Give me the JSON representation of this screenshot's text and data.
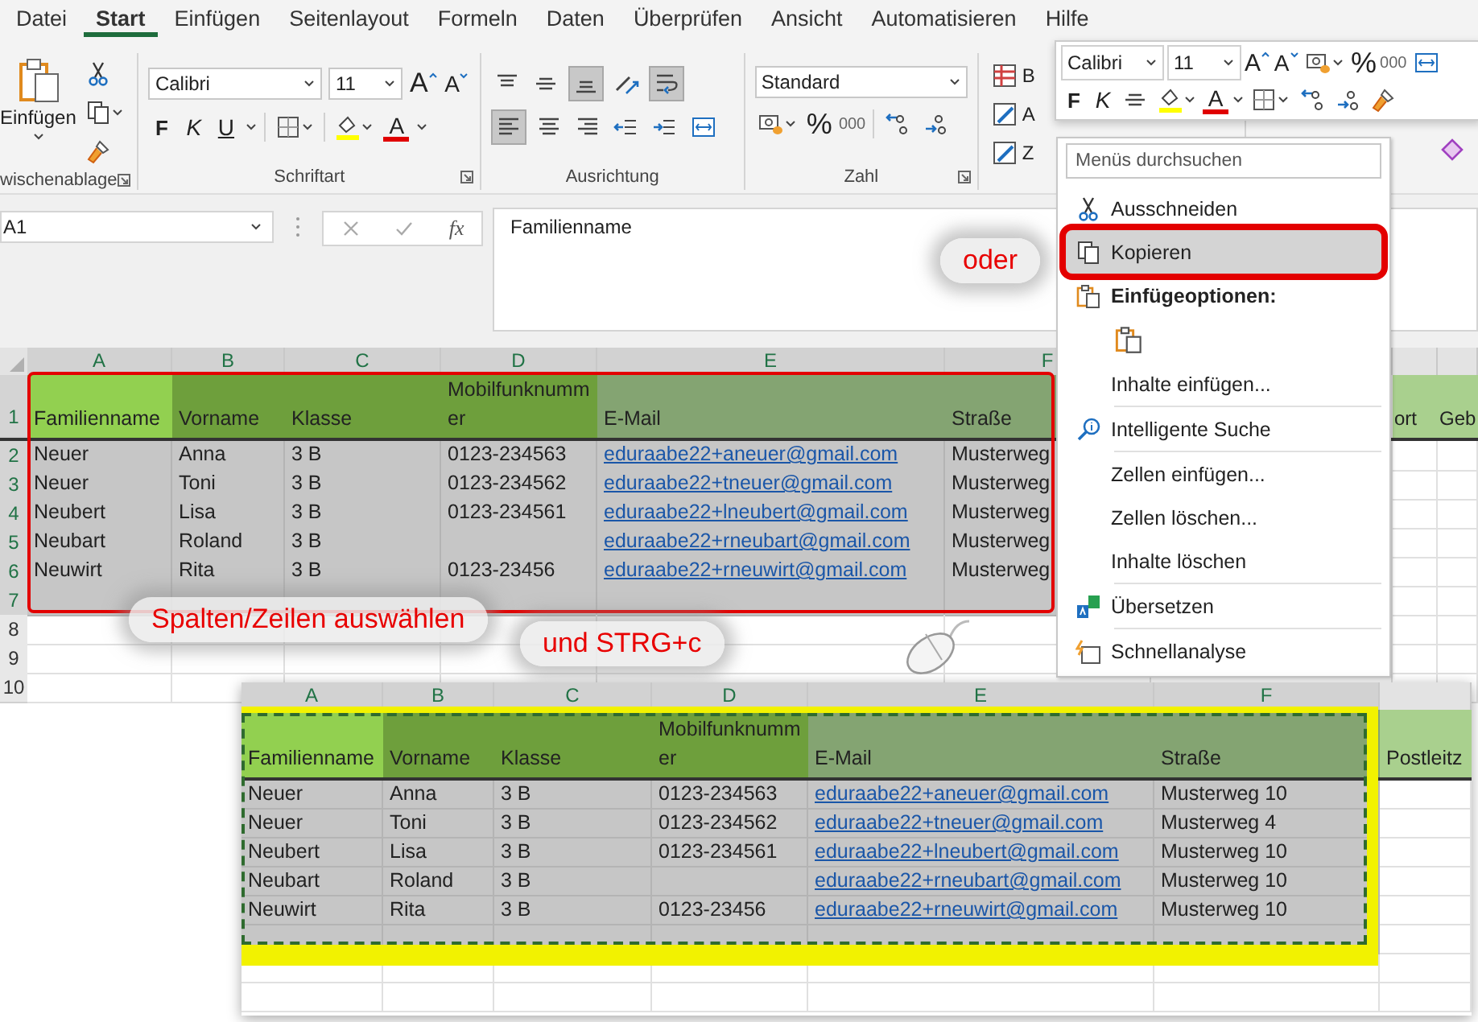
{
  "menu_tabs": [
    {
      "label": "Datei",
      "selected": false
    },
    {
      "label": "Start",
      "selected": true
    },
    {
      "label": "Einfügen",
      "selected": false
    },
    {
      "label": "Seitenlayout",
      "selected": false
    },
    {
      "label": "Formeln",
      "selected": false
    },
    {
      "label": "Daten",
      "selected": false
    },
    {
      "label": "Überprüfen",
      "selected": false
    },
    {
      "label": "Ansicht",
      "selected": false
    },
    {
      "label": "Automatisieren",
      "selected": false
    },
    {
      "label": "Hilfe",
      "selected": false
    }
  ],
  "ribbon": {
    "clipboard": {
      "paste": "Einfügen",
      "group": "wischenablage"
    },
    "font": {
      "family": "Calibri",
      "size": "11",
      "grow": "A",
      "shrink": "A",
      "bold": "F",
      "italic": "K",
      "underline": "U",
      "font_color": "A",
      "group": "Schriftart"
    },
    "alignment": {
      "group": "Ausrichtung",
      "buttons": [
        {
          "kind": "align-top",
          "selected": false
        },
        {
          "kind": "align-middle",
          "selected": false
        },
        {
          "kind": "align-bottom",
          "selected": true
        },
        {
          "kind": "orient",
          "selected": false
        },
        {
          "kind": "wrap",
          "selected": true
        },
        {
          "kind": "align-left",
          "selected": true
        },
        {
          "kind": "align-center",
          "selected": false
        },
        {
          "kind": "align-right",
          "selected": false
        },
        {
          "kind": "outdent",
          "selected": false
        },
        {
          "kind": "indent",
          "selected": false
        },
        {
          "kind": "merge",
          "selected": false
        }
      ]
    },
    "number": {
      "format": "Standard",
      "percent": "%",
      "thousands": "000",
      "group": "Zahl"
    },
    "styles": {
      "items": [
        "B",
        "A",
        "Z"
      ]
    }
  },
  "formula_bar": {
    "name_box": "A1",
    "function_symbol": "fx",
    "formula": "Familienname"
  },
  "sheet": {
    "columns": [
      "A",
      "B",
      "C",
      "D",
      "E",
      "F"
    ],
    "header_row": {
      "number": "1",
      "cells": [
        {
          "text": "Familienname",
          "color": "#92d050"
        },
        {
          "text": "Vorname",
          "color": "#6e9f3c"
        },
        {
          "text": "Klasse",
          "color": "#6e9f3c"
        },
        {
          "text": "Mobilfunknummer",
          "color": "#6e9f3c"
        },
        {
          "text": "E-Mail",
          "color": "#84a472"
        },
        {
          "text": "Straße",
          "color": "#84a472"
        },
        {
          "text": "ort",
          "color": "#a9d08e"
        },
        {
          "text": "Geb",
          "color": "#a9d08e"
        }
      ]
    },
    "rows": [
      {
        "number": "2",
        "selected": true,
        "cells": [
          "Neuer",
          "Anna",
          "3 B",
          "0123-234563",
          "eduraabe22+aneuer@gmail.com",
          "Musterweg"
        ]
      },
      {
        "number": "3",
        "selected": true,
        "cells": [
          "Neuer",
          "Toni",
          "3 B",
          "0123-234562",
          "eduraabe22+tneuer@gmail.com",
          "Musterweg"
        ]
      },
      {
        "number": "4",
        "selected": true,
        "cells": [
          "Neubert",
          "Lisa",
          "3 B",
          "0123-234561",
          "eduraabe22+lneubert@gmail.com",
          "Musterweg"
        ]
      },
      {
        "number": "5",
        "selected": true,
        "cells": [
          "Neubart",
          "Roland",
          "3 B",
          null,
          "eduraabe22+rneubart@gmail.com",
          "Musterweg"
        ]
      },
      {
        "number": "6",
        "selected": true,
        "cells": [
          "Neuwirt",
          "Rita",
          "3 B",
          "0123-23456",
          "eduraabe22+rneuwirt@gmail.com",
          "Musterweg"
        ]
      },
      {
        "number": "7",
        "selected": true
      },
      {
        "number": "8",
        "selected": false
      },
      {
        "number": "9",
        "selected": false
      },
      {
        "number": "10",
        "selected": false
      }
    ]
  },
  "annotations": [
    {
      "text": "oder"
    },
    {
      "text": "Spalten/Zeilen auswählen"
    },
    {
      "text": "und STRG+c"
    }
  ],
  "mini_toolbar": {
    "font": "Calibri",
    "size": "11",
    "grow": "A",
    "shrink": "A",
    "percent": "%",
    "thousands": "000",
    "bold": "F",
    "italic": "K",
    "font_color": "A"
  },
  "context_menu": {
    "search_placeholder": "Menüs durchsuchen",
    "items": [
      {
        "kind": "cut",
        "label": "Ausschneiden",
        "selected": false
      },
      {
        "kind": "copy",
        "label": "Kopieren",
        "selected": true
      },
      {
        "kind": "heading",
        "label": "Einfügeoptionen:"
      },
      {
        "kind": "paste-option"
      },
      {
        "kind": "plain",
        "label": "Inhalte einfügen...",
        "selected": false
      },
      {
        "kind": "separator"
      },
      {
        "kind": "smart-lookup",
        "label": "Intelligente Suche",
        "selected": false
      },
      {
        "kind": "separator"
      },
      {
        "kind": "plain",
        "label": "Zellen einfügen...",
        "selected": false
      },
      {
        "kind": "plain",
        "label": "Zellen löschen...",
        "selected": false
      },
      {
        "kind": "plain",
        "label": "Inhalte löschen",
        "selected": false
      },
      {
        "kind": "separator"
      },
      {
        "kind": "translate",
        "label": "Übersetzen",
        "selected": false
      },
      {
        "kind": "separator"
      },
      {
        "kind": "quick-analysis",
        "label": "Schnellanalyse",
        "selected": false
      }
    ]
  },
  "pasted_sheet": {
    "columns": [
      "A",
      "B",
      "C",
      "D",
      "E",
      "F"
    ],
    "header_row": {
      "cells": [
        {
          "text": "Familienname",
          "color": "#92d050"
        },
        {
          "text": "Vorname",
          "color": "#6e9f3c"
        },
        {
          "text": "Klasse",
          "color": "#6e9f3c"
        },
        {
          "text": "Mobilfunknummer",
          "color": "#6e9f3c"
        },
        {
          "text": "E-Mail",
          "color": "#84a472"
        },
        {
          "text": "Straße",
          "color": "#84a472"
        },
        {
          "text": "Postleitz",
          "color": "#a9d08e"
        }
      ]
    },
    "rows": [
      {
        "selected": true,
        "cells": [
          "Neuer",
          "Anna",
          "3 B",
          "0123-234563",
          "eduraabe22+aneuer@gmail.com",
          "Musterweg 10"
        ]
      },
      {
        "selected": true,
        "cells": [
          "Neuer",
          "Toni",
          "3 B",
          "0123-234562",
          "eduraabe22+tneuer@gmail.com",
          "Musterweg 4"
        ]
      },
      {
        "selected": true,
        "cells": [
          "Neubert",
          "Lisa",
          "3 B",
          "0123-234561",
          "eduraabe22+lneubert@gmail.com",
          "Musterweg 10"
        ]
      },
      {
        "selected": true,
        "cells": [
          "Neubart",
          "Roland",
          "3 B",
          null,
          "eduraabe22+rneubart@gmail.com",
          "Musterweg 10"
        ]
      },
      {
        "selected": true,
        "cells": [
          "Neuwirt",
          "Rita",
          "3 B",
          "0123-23456",
          "eduraabe22+rneuwirt@gmail.com",
          "Musterweg 10"
        ]
      },
      {
        "selected": true
      },
      {
        "selected": false
      },
      {
        "selected": false
      }
    ]
  }
}
